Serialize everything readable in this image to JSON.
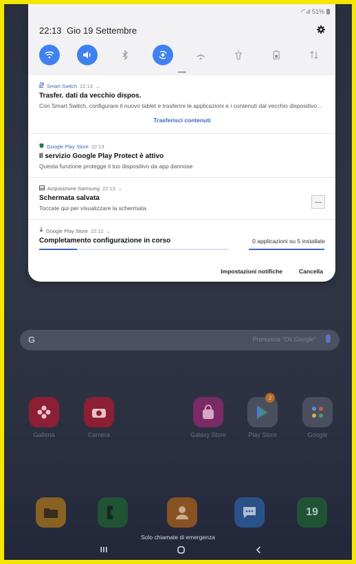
{
  "status_bar": {
    "battery": "51%"
  },
  "quick_settings": {
    "time": "22:13",
    "date": "Gio 19 Settembre",
    "toggles": [
      {
        "name": "wifi",
        "on": true
      },
      {
        "name": "sound",
        "on": true
      },
      {
        "name": "bluetooth",
        "on": false
      },
      {
        "name": "auto-rotate",
        "on": true
      },
      {
        "name": "airplane",
        "on": false
      },
      {
        "name": "flashlight",
        "on": false
      },
      {
        "name": "power-saving",
        "on": false
      },
      {
        "name": "mobile-data",
        "on": false
      }
    ]
  },
  "notifications": [
    {
      "app": "Smart Switch",
      "time": "22:13",
      "title": "Trasfer. dati da vecchio dispos.",
      "text": "Con Smart Switch, configurare il nuovo tablet e trasferire le applicazioni e i contenuti dal vecchio dispositivo ..",
      "action": "Trasferisci contenuti"
    },
    {
      "app": "Google Play Store",
      "time": "22:13",
      "title": "Il servizio Google Play Protect è attivo",
      "text": "Questa funzione protegge il tuo dispositivo da app dannose"
    },
    {
      "app": "Acquisizione Samsung",
      "time": "22:13",
      "title": "Schermata salvata",
      "text": "Toccate qui per visualizzare la schermata."
    },
    {
      "app": "Google Play Store",
      "time": "22:12",
      "title": "Completamento configurazione in corso",
      "status": "0 applicazioni su 5 installate",
      "progress_left": 0.2,
      "progress_right": 0.0
    }
  ],
  "footer": {
    "settings": "Impostazioni notifiche",
    "cancel": "Cancella"
  },
  "home": {
    "search_hint": "Pronuncia \"Ok Google\"",
    "search_logo": "G",
    "apps": [
      {
        "label": "Galleria",
        "color": "#8c1f33"
      },
      {
        "label": "Camera",
        "color": "#8c1f33"
      },
      {
        "label": "Galaxy Store",
        "color": "#7a2a66"
      },
      {
        "label": "Play Store",
        "color": "#4a4f5f",
        "badge": "2"
      },
      {
        "label": "Google",
        "color": "#4a4f5f"
      }
    ],
    "dock": [
      {
        "name": "folder",
        "color": "#9a6c1e"
      },
      {
        "name": "phone",
        "color": "#1f5a33"
      },
      {
        "name": "contacts",
        "color": "#9a5a1e"
      },
      {
        "name": "messages",
        "color": "#2a5a96"
      },
      {
        "name": "calendar",
        "color": "#1f5a33",
        "text": "19"
      }
    ],
    "emergency": "Solo chiamate di emergenza"
  }
}
